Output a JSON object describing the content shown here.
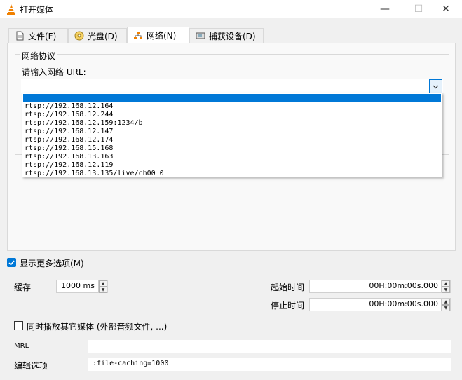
{
  "window": {
    "title": "打开媒体",
    "minimize_glyph": "—",
    "maximize_glyph": "☐",
    "close_glyph": "✕"
  },
  "tabs": [
    {
      "label": "文件(F)",
      "icon": "file-icon"
    },
    {
      "label": "光盘(D)",
      "icon": "disc-icon"
    },
    {
      "label": "网络(N)",
      "icon": "network-icon",
      "active": true
    },
    {
      "label": "捕获设备(D)",
      "icon": "capture-icon"
    }
  ],
  "network": {
    "group_title": "网络协议",
    "url_label": "请输入网络 URL:",
    "url_value": "",
    "history": [
      "rtsp://192.168.12.164",
      "rtsp://192.168.12.244",
      "rtsp://192.168.12.159:1234/b",
      "rtsp://192.168.12.147",
      "rtsp://192.168.12.174",
      "rtsp://192.168.15.168",
      "rtsp://192.168.13.163",
      "rtsp://192.168.12.119",
      "rtsp://192.168.13.135/live/ch00_0"
    ]
  },
  "options": {
    "show_more_label": "显示更多选项(M)",
    "show_more_checked": true,
    "cache_label": "缓存",
    "cache_value": "1000 ms",
    "start_label": "起始时间",
    "start_value": "00H:00m:00s.000",
    "stop_label": "停止时间",
    "stop_value": "00H:00m:00s.000",
    "sync_label": "同时播放其它媒体 (外部音频文件, ...)",
    "sync_checked": false,
    "mrl_label": "MRL",
    "mrl_value": "",
    "edit_label": "编辑选项",
    "edit_value": ":file-caching=1000"
  },
  "colors": {
    "accent": "#0078d7",
    "vlc_orange": "#f08000"
  }
}
